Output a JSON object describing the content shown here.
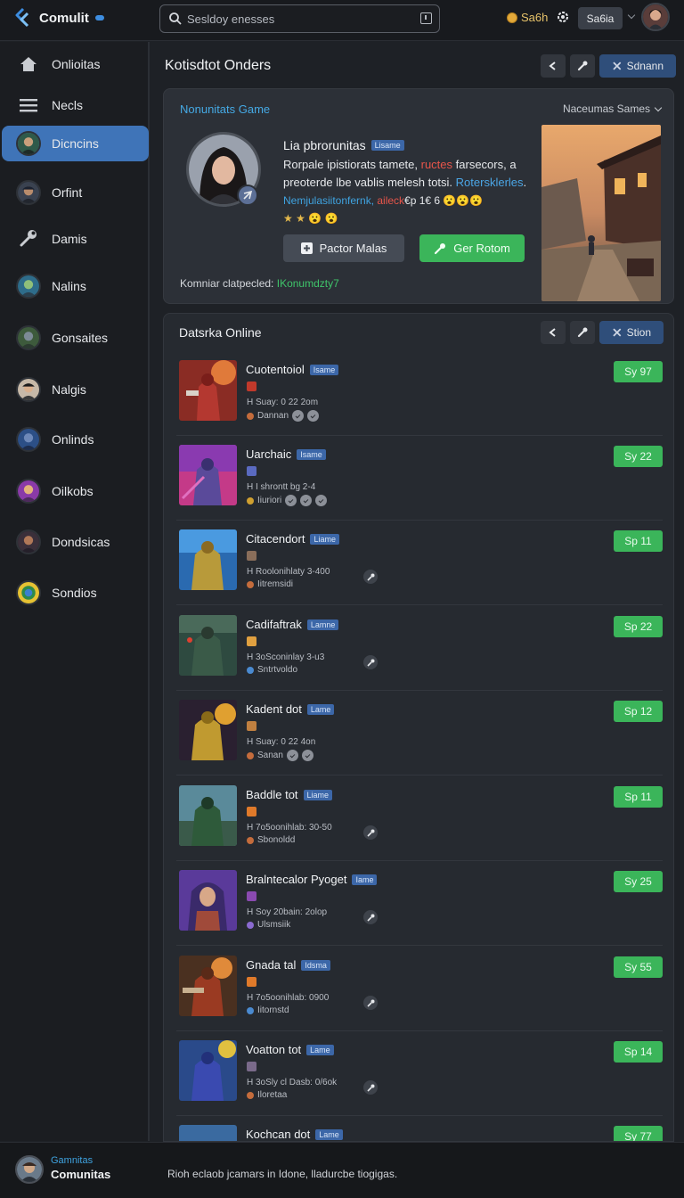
{
  "app": {
    "name": "Comulit"
  },
  "search": {
    "placeholder": "Sesldoy enesses"
  },
  "header": {
    "coins": "Sa6h",
    "button": "Sa6ia"
  },
  "sidebar": {
    "items": [
      {
        "label": "Onlioitas",
        "icon": "home-icon"
      },
      {
        "label": "Necls",
        "icon": "menu-icon"
      },
      {
        "label": "Dicncins",
        "icon": "avatar",
        "active": true
      },
      {
        "label": "Orfint",
        "icon": "avatar"
      },
      {
        "label": "Damis",
        "icon": "wrench-icon"
      },
      {
        "label": "Nalins",
        "icon": "avatar"
      },
      {
        "label": "Gonsaites",
        "icon": "avatar"
      },
      {
        "label": "Nalgis",
        "icon": "avatar"
      },
      {
        "label": "Onlinds",
        "icon": "avatar"
      },
      {
        "label": "Oilkobs",
        "icon": "avatar"
      },
      {
        "label": "Dondsicas",
        "icon": "avatar"
      },
      {
        "label": "Sondios",
        "icon": "avatar"
      }
    ]
  },
  "main": {
    "title": "Kotisdtot Onders",
    "toolbar": {
      "action_label": "Sdnann"
    }
  },
  "featured": {
    "heading": "Nonunitats Game",
    "sort_label": "Naceumas Sames",
    "name": "Lia pbrorunitas",
    "tag": "Lisame",
    "line2_a": "Rorpale ipistiorats tamete, ",
    "line2_red": "ructes",
    "line2_b": " farsecors, a",
    "line3_a": "preoterde lbe vablis melesh totsi. ",
    "line3_blue": "Rotersklerles",
    "line3_b": ".",
    "line4_a": "Nemjulasiitonfernk, ",
    "line4_red": "aileck",
    "line4_b": "€p 1€ 6 😮😮😮",
    "line5": "★ ★ 😮 😮",
    "btn_secondary": "Pactor Malas",
    "btn_primary": "Ger Rotom",
    "footer_label": "Komniar clatpecled: ",
    "footer_value": "IKonumdzty7"
  },
  "list": {
    "heading": "Datsrka Online",
    "action_label": "Stion",
    "rows": [
      {
        "title": "Cuotentoiol",
        "tag": "Isame",
        "meta": "H Suay: 0 22 2om",
        "sub": "Dannan",
        "score": "Sy 97"
      },
      {
        "title": "Uarchaic",
        "tag": "Isame",
        "meta": "H I shrontt bg 2-4",
        "sub": "Iiuriori",
        "score": "Sy 22"
      },
      {
        "title": "Citacendort",
        "tag": "Liame",
        "meta": "H Roolonihlaty 3-400",
        "sub": "Iitremsidi",
        "score": "Sp 11"
      },
      {
        "title": "Cadifaftrak",
        "tag": "Lamne",
        "meta": "H 3oSconinlay 3-u3",
        "sub": "Sntrtvoldo",
        "score": "Sp 22"
      },
      {
        "title": "Kadent dot",
        "tag": "Lame",
        "meta": "H Suay: 0 22 4on",
        "sub": "Sanan",
        "score": "Sp 12"
      },
      {
        "title": "Baddle tot",
        "tag": "Liame",
        "meta": "H 7o5oonihlab: 30-50",
        "sub": "Sbonoldd",
        "score": "Sp 11"
      },
      {
        "title": "Bralntecalor Pyoget",
        "tag": "Iame",
        "meta": "H Soy 20bain: 2olop",
        "sub": "Ulsmsiik",
        "score": "Sy 25"
      },
      {
        "title": "Gnada tal",
        "tag": "Idsma",
        "meta": "H 7o5oonihlab: 0900",
        "sub": "Iitornstd",
        "score": "Sy 55"
      },
      {
        "title": "Voatton tot",
        "tag": "Lame",
        "meta": "H 3oSly cl Dasb: 0/6ok",
        "sub": "Iloretaa",
        "score": "Sp 14"
      },
      {
        "title": "Kochcan dot",
        "tag": "Lame",
        "meta": "",
        "sub": "",
        "score": "Sy 77"
      }
    ]
  },
  "footer": {
    "line1": "Gamnitas",
    "line2": "Comunitas",
    "message": "Rioh eclaob jcamars in Idone, lladurcbe tiogigas."
  }
}
